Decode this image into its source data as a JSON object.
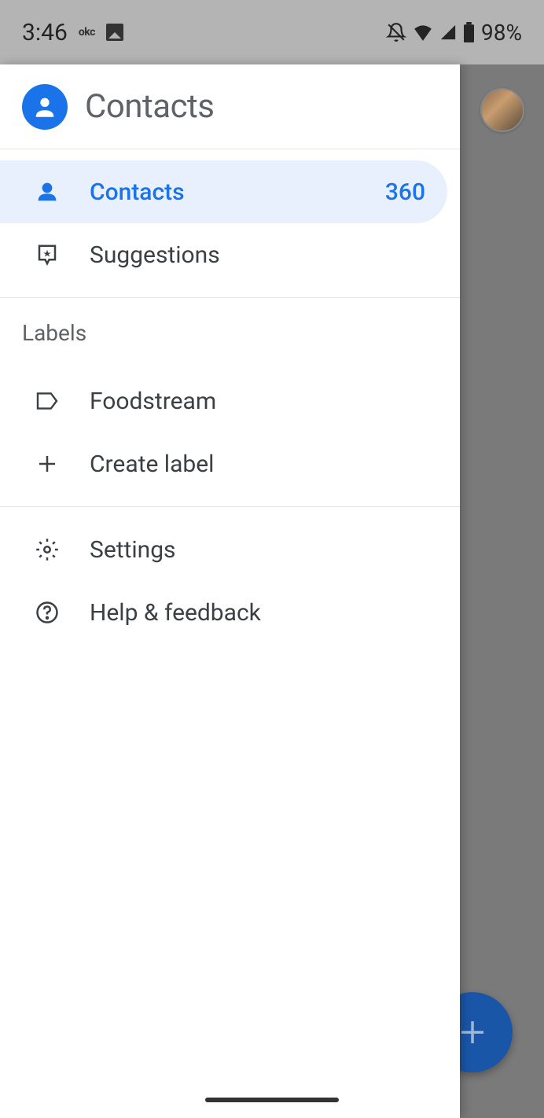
{
  "status": {
    "time": "3:46",
    "okc": "okc",
    "battery": "98%"
  },
  "drawer": {
    "title": "Contacts",
    "items": {
      "contacts": {
        "label": "Contacts",
        "count": "360"
      },
      "suggestions": {
        "label": "Suggestions"
      }
    },
    "labels_section": "Labels",
    "labels": {
      "foodstream": {
        "label": "Foodstream"
      },
      "create": {
        "label": "Create label"
      }
    },
    "settings": {
      "label": "Settings"
    },
    "help": {
      "label": "Help & feedback"
    }
  }
}
